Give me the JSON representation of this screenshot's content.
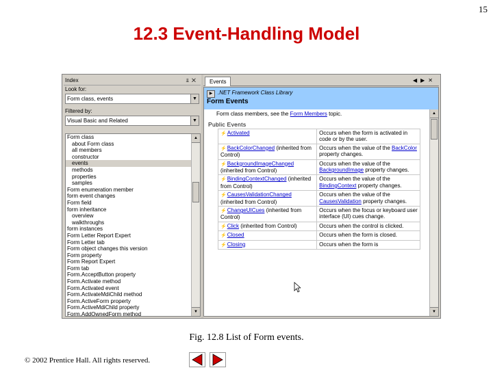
{
  "slide": {
    "number": "15",
    "title": "12.3 Event-Handling Model",
    "caption": "Fig. 12.8   List of Form events.",
    "copyright": "© 2002 Prentice Hall.  All rights reserved.",
    "accent_color": "#cc0000",
    "nav_arrow_color": "#cc0000"
  },
  "index_pane": {
    "title": "Index",
    "look_for_label": "Look for:",
    "look_for_value": "Form class, events",
    "filter_label": "Filtered by:",
    "filter_value": "Visual Basic and Related",
    "items": [
      {
        "text": "Form class",
        "level": 0
      },
      {
        "text": "about Form class",
        "level": 1
      },
      {
        "text": "all members",
        "level": 1
      },
      {
        "text": "constructor",
        "level": 1
      },
      {
        "text": "events",
        "level": 1,
        "selected": true
      },
      {
        "text": "methods",
        "level": 1
      },
      {
        "text": "properties",
        "level": 1
      },
      {
        "text": "samples",
        "level": 1
      },
      {
        "text": "Form enumeration member",
        "level": 0
      },
      {
        "text": "form event changes",
        "level": 0
      },
      {
        "text": "Form field",
        "level": 0
      },
      {
        "text": "form inheritance",
        "level": 0
      },
      {
        "text": "overview",
        "level": 1
      },
      {
        "text": "walkthroughs",
        "level": 1
      },
      {
        "text": "form instances",
        "level": 0
      },
      {
        "text": "Form Letter Report Expert",
        "level": 0
      },
      {
        "text": "Form Letter tab",
        "level": 0
      },
      {
        "text": "Form object changes this version",
        "level": 0
      },
      {
        "text": "Form property",
        "level": 0
      },
      {
        "text": "Form Report Expert",
        "level": 0
      },
      {
        "text": "Form tab",
        "level": 0
      },
      {
        "text": "Form.AcceptButton property",
        "level": 0
      },
      {
        "text": "Form.Activate method",
        "level": 0
      },
      {
        "text": "Form.Activated event",
        "level": 0
      },
      {
        "text": "Form.ActivateMdiChild method",
        "level": 0
      },
      {
        "text": "Form.ActiveForm property",
        "level": 0
      },
      {
        "text": "Form.ActiveMdiChild property",
        "level": 0
      },
      {
        "text": "Form.AddOwnedForm method",
        "level": 0
      }
    ]
  },
  "content_pane": {
    "tab_label": "Events",
    "library_name": ".NET Framework Class Library",
    "page_title": "Form Events",
    "intro_prefix": "Form class members, see the",
    "intro_link": "Form Members",
    "intro_suffix": "topic.",
    "section_heading": "Public Events",
    "events": [
      {
        "name": "Activated",
        "suffix": "",
        "desc_parts": [
          "Occurs when the form is activated in code or by the user."
        ]
      },
      {
        "name": "BackColorChanged",
        "suffix": " (inherited from Control)",
        "desc_parts": [
          "Occurs when the value of the ",
          "BackColor",
          " property changes."
        ]
      },
      {
        "name": "BackgroundImageChanged",
        "suffix": " (inherited from Control)",
        "desc_parts": [
          "Occurs when the value of the ",
          "BackgroundImage",
          " property changes."
        ]
      },
      {
        "name": "BindingContextChanged",
        "suffix": " (inherited from Control)",
        "desc_parts": [
          "Occurs when the value of the ",
          "BindingContext",
          " property changes."
        ]
      },
      {
        "name": "CausesValidationChanged",
        "suffix": " (inherited from Control)",
        "desc_parts": [
          "Occurs when the value of the ",
          "CausesValidation",
          " property changes."
        ]
      },
      {
        "name": "ChangeUICues",
        "suffix": " (inherited from Control)",
        "desc_parts": [
          "Occurs when the focus or keyboard user interface (UI) cues change."
        ]
      },
      {
        "name": "Click",
        "suffix": " (inherited from Control)",
        "desc_parts": [
          "Occurs when the control is clicked."
        ]
      },
      {
        "name": "Closed",
        "suffix": "",
        "desc_parts": [
          "Occurs when the form is closed."
        ]
      },
      {
        "name": "Closing",
        "suffix": "",
        "desc_parts": [
          "Occurs when the form is"
        ]
      }
    ]
  }
}
